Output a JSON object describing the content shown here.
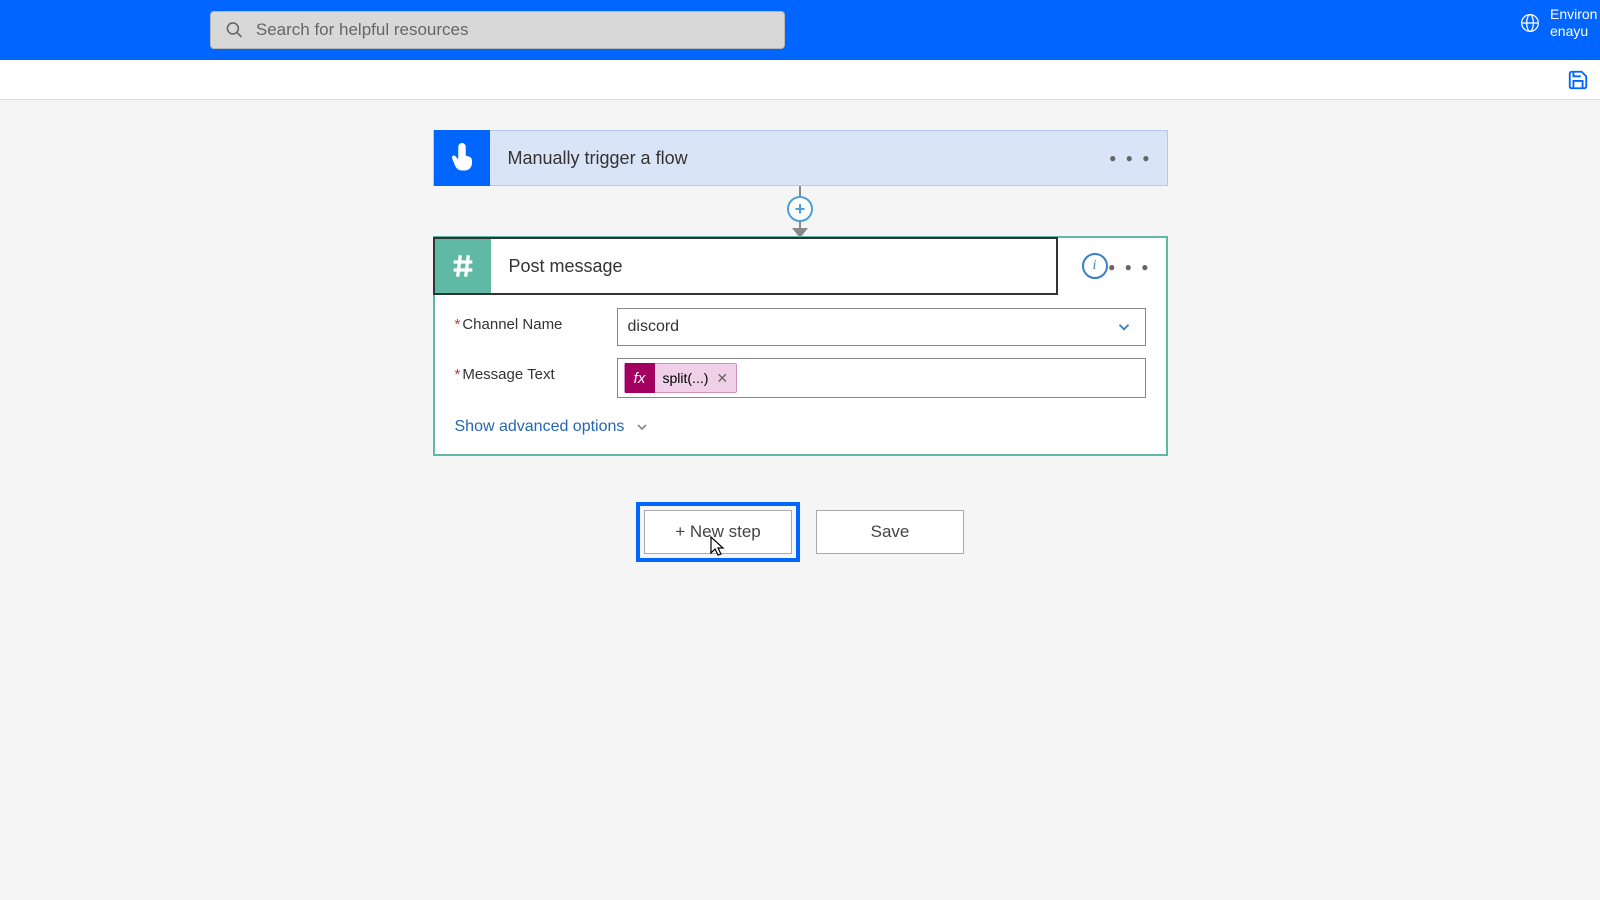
{
  "header": {
    "search_placeholder": "Search for helpful resources",
    "env_label": "Environ",
    "env_value": "enayu"
  },
  "trigger": {
    "title": "Manually trigger a flow"
  },
  "action": {
    "title": "Post message",
    "fields": {
      "channel_label": "Channel Name",
      "channel_value": "discord",
      "message_label": "Message Text",
      "token_fx": "fx",
      "token_text": "split(...)"
    },
    "advanced": "Show advanced options"
  },
  "buttons": {
    "new_step": "+ New step",
    "save": "Save"
  }
}
